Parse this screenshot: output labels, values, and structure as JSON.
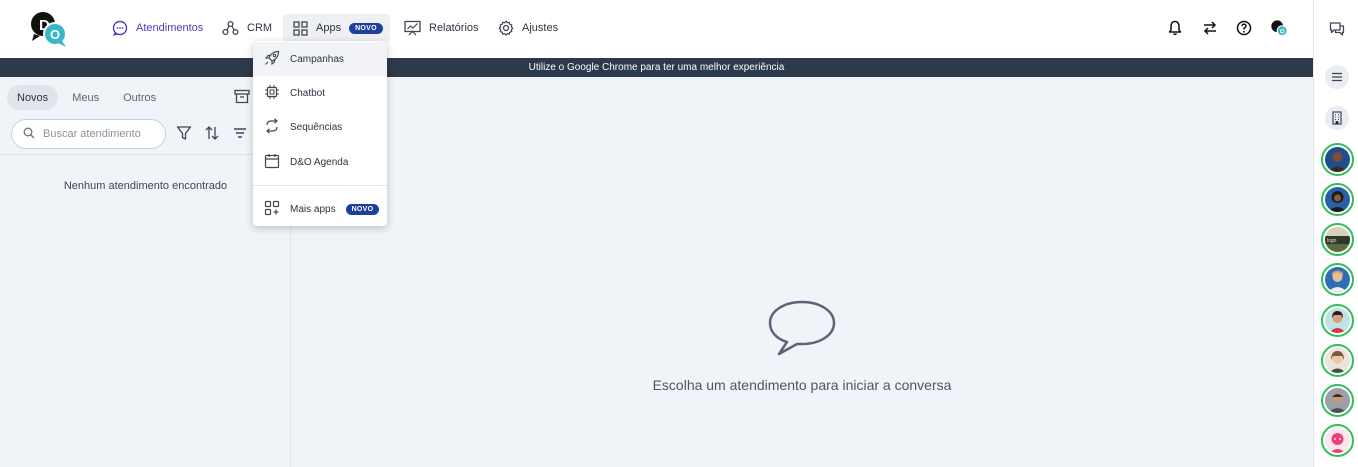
{
  "nav": {
    "atendimentos": "Atendimentos",
    "crm": "CRM",
    "apps": "Apps",
    "apps_badge": "NOVO",
    "relatorios": "Relatórios",
    "ajustes": "Ajustes"
  },
  "banner": "Utilize o Google Chrome para ter uma melhor experiência",
  "left_panel": {
    "tabs": [
      "Novos",
      "Meus",
      "Outros"
    ],
    "active_tab": "Novos",
    "search_placeholder": "Buscar atendimento",
    "empty_message": "Nenhum atendimento encontrado"
  },
  "main": {
    "empty_message": "Escolha um atendimento para iniciar a conversa"
  },
  "apps_menu": {
    "items": [
      {
        "label": "Campanhas",
        "icon": "rocket-icon"
      },
      {
        "label": "Chatbot",
        "icon": "chip-icon"
      },
      {
        "label": "Sequências",
        "icon": "repeat-icon"
      },
      {
        "label": "D&O Agenda",
        "icon": "calendar-icon"
      }
    ],
    "more": {
      "label": "Mais apps",
      "badge": "NOVO",
      "icon": "apps-plus-icon"
    }
  },
  "colors": {
    "accent": "#4a3fbf",
    "badge": "#1f3f9e",
    "banner": "#2d3a4b",
    "panel_bg": "#f0f3f7",
    "online": "#2fbf5a"
  },
  "avatars_count": 8
}
